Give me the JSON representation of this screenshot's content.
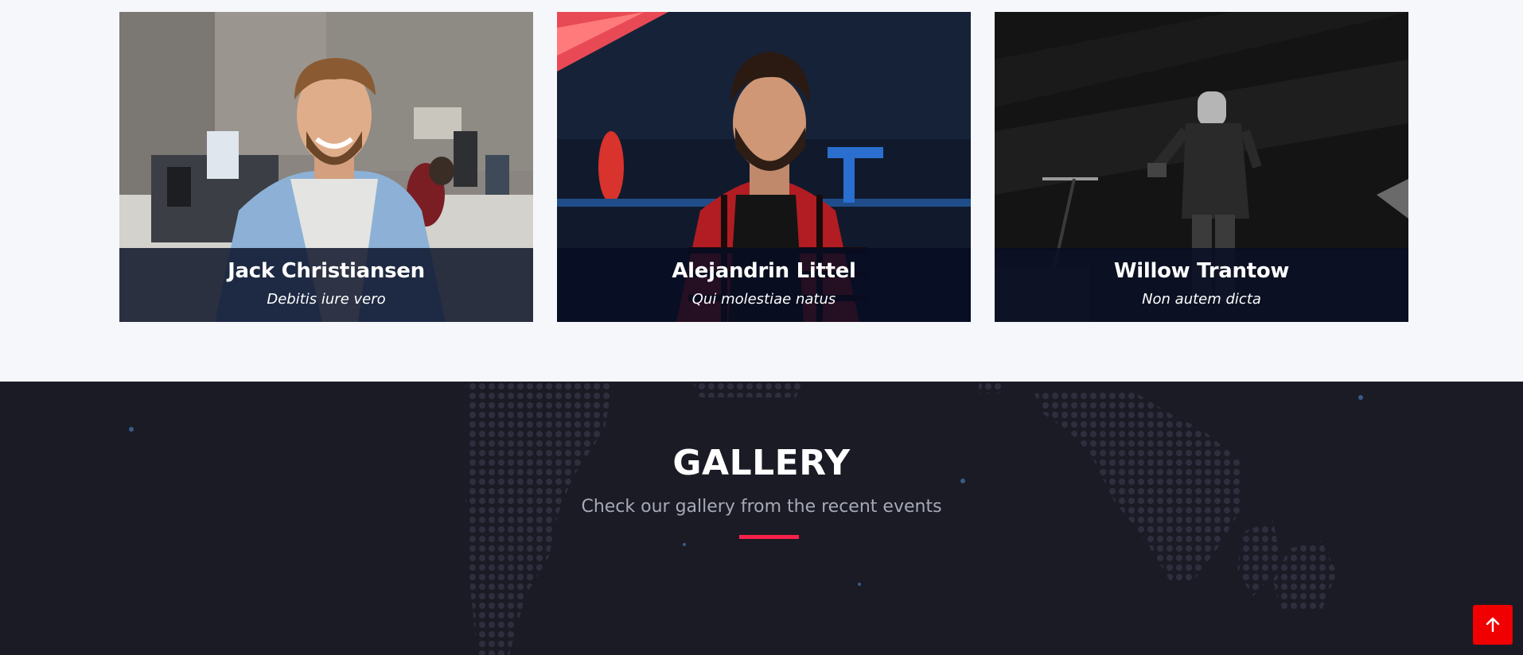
{
  "speakers": [
    {
      "name": "Jack Christiansen",
      "role": "Debitis iure vero",
      "photo_icon": "portrait-photo"
    },
    {
      "name": "Alejandrin Littel",
      "role": "Qui molestiae natus",
      "photo_icon": "portrait-photo"
    },
    {
      "name": "Willow Trantow",
      "role": "Non autem dicta",
      "photo_icon": "portrait-photo"
    }
  ],
  "gallery": {
    "title": "GALLERY",
    "subtitle": "Check our gallery from the recent events"
  },
  "back_to_top": {
    "icon": "arrow-up-icon"
  },
  "colors": {
    "accent": "#f82249",
    "back_to_top": "#f00000",
    "dark_bg": "#1b1b25",
    "light_bg": "#f6f7fb",
    "overlay": "#060c22"
  }
}
